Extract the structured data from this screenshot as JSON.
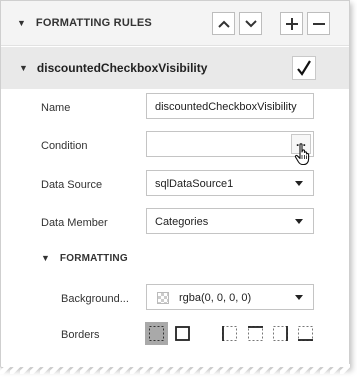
{
  "rules_section": {
    "title": "FORMATTING RULES"
  },
  "toolbar": {
    "move_up": "move up",
    "move_down": "move down",
    "add": "add",
    "remove": "remove"
  },
  "rule": {
    "name": "discountedCheckboxVisibility",
    "enabled": true
  },
  "properties": {
    "name": {
      "label": "Name",
      "value": "discountedCheckboxVisibility"
    },
    "condition": {
      "label": "Condition",
      "value": "",
      "button": "..."
    },
    "data_source": {
      "label": "Data Source",
      "value": "sqlDataSource1"
    },
    "data_member": {
      "label": "Data Member",
      "value": "Categories"
    }
  },
  "formatting": {
    "title": "FORMATTING",
    "background": {
      "label": "Background...",
      "value": "rgba(0, 0, 0, 0)"
    },
    "borders": {
      "label": "Borders"
    }
  },
  "colors": {
    "header_bg": "#f4f4f4",
    "rule_bg": "#e9e9e9",
    "active_border_btn": "#a9a9a9"
  }
}
